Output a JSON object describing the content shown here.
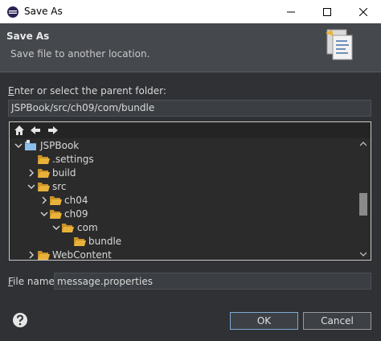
{
  "window": {
    "title": "Save As",
    "controls": {
      "minimize": "minimize-icon",
      "maximize": "maximize-icon",
      "close": "close-icon"
    }
  },
  "header": {
    "title": "Save As",
    "subtitle": "Save file to another location."
  },
  "parent_folder": {
    "label_prefix": "E",
    "label_rest": "nter or select the parent folder:",
    "value": "JSPBook/src/ch09/com/bundle"
  },
  "tree": {
    "toolbar": [
      "home-icon",
      "back-arrow-icon",
      "forward-arrow-icon"
    ],
    "items": [
      {
        "label": "JSPBook",
        "expanded": true,
        "type": "project"
      },
      {
        "label": ".settings",
        "expanded": false,
        "type": "folder",
        "has_children": false
      },
      {
        "label": "build",
        "expanded": false,
        "type": "folder",
        "has_children": true
      },
      {
        "label": "src",
        "expanded": true,
        "type": "folder",
        "has_children": true
      },
      {
        "label": "ch04",
        "expanded": false,
        "type": "folder",
        "has_children": true
      },
      {
        "label": "ch09",
        "expanded": true,
        "type": "folder",
        "has_children": true
      },
      {
        "label": "com",
        "expanded": true,
        "type": "folder",
        "has_children": true
      },
      {
        "label": "bundle",
        "expanded": false,
        "type": "folder",
        "has_children": false,
        "selected": true
      },
      {
        "label": "WebContent",
        "expanded": false,
        "type": "folder",
        "has_children": true
      }
    ]
  },
  "file_name": {
    "label_prefix": "F",
    "label_rest": "ile name:",
    "value": "message.properties"
  },
  "buttons": {
    "ok": "OK",
    "cancel": "Cancel"
  },
  "colors": {
    "folder": "#e8b23a",
    "accent_border": "#7fa9d6",
    "background": "#2f3134"
  }
}
